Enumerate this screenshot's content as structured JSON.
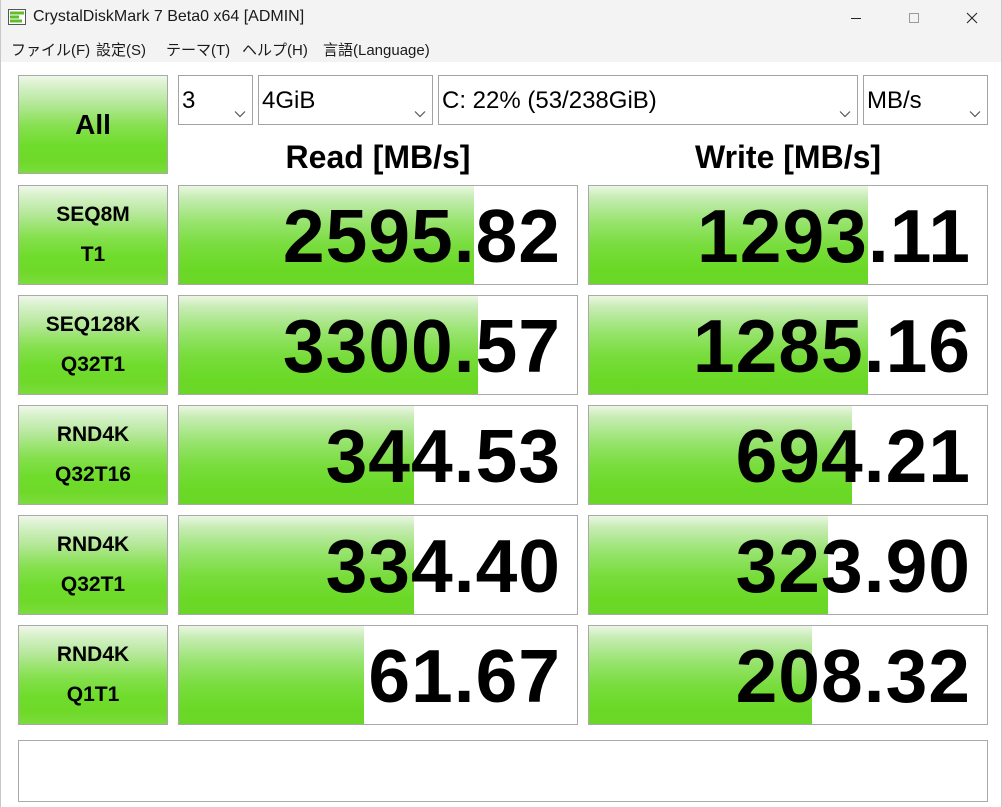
{
  "window": {
    "title": "CrystalDiskMark 7 Beta0 x64 [ADMIN]",
    "app_icon": "crystaldiskmark-icon",
    "controls": [
      "minimize-icon",
      "maximize-icon",
      "close-icon"
    ]
  },
  "menu": {
    "items": [
      "ファイル(F)",
      "設定(S)",
      "テーマ(T)",
      "ヘルプ(H)",
      "言語(Language)"
    ]
  },
  "toolbar": {
    "all_label": "All",
    "count": "3",
    "size": "4GiB",
    "drive": "C: 22% (53/238GiB)",
    "unit": "MB/s"
  },
  "columns": {
    "read": "Read [MB/s]",
    "write": "Write [MB/s]"
  },
  "tests": [
    {
      "line1": "SEQ8M",
      "line2": "T1",
      "read": "2595.82",
      "write": "1293.11",
      "read_fill": 0.74,
      "write_fill": 0.7
    },
    {
      "line1": "SEQ128K",
      "line2": "Q32T1",
      "read": "3300.57",
      "write": "1285.16",
      "read_fill": 0.75,
      "write_fill": 0.7
    },
    {
      "line1": "RND4K",
      "line2": "Q32T16",
      "read": "344.53",
      "write": "694.21",
      "read_fill": 0.59,
      "write_fill": 0.66
    },
    {
      "line1": "RND4K",
      "line2": "Q32T1",
      "read": "334.40",
      "write": "323.90",
      "read_fill": 0.59,
      "write_fill": 0.6
    },
    {
      "line1": "RND4K",
      "line2": "Q1T1",
      "read": "61.67",
      "write": "208.32",
      "read_fill": 0.465,
      "write_fill": 0.56
    }
  ],
  "comment": "",
  "colors": {
    "fill_green": "#6fd92a",
    "border": "#a9a9a9",
    "titlebar_bg": "#f3f3f3"
  }
}
